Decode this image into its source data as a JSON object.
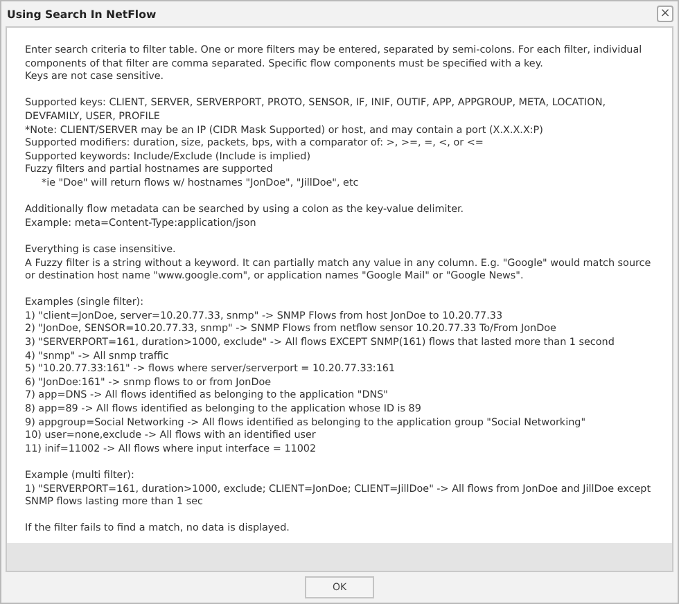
{
  "window": {
    "title": "Using Search In NetFlow",
    "close_symbol": "×"
  },
  "paragraphs": [
    [
      {
        "kind": "plain",
        "text": "Enter search criteria to filter table. One or more filters may be entered, separated by semi-colons. For each filter, individual components of that filter are comma separated. Specific flow components must be specified with a key."
      },
      {
        "kind": "plain",
        "text": "Keys are not case sensitive."
      }
    ],
    [
      {
        "kind": "plain",
        "text": "Supported keys: CLIENT, SERVER, SERVERPORT, PROTO, SENSOR, IF, INIF, OUTIF, APP, APPGROUP, META, LOCATION, DEVFAMILY, USER, PROFILE"
      },
      {
        "kind": "plain",
        "text": "*Note: CLIENT/SERVER may be an IP (CIDR Mask Supported) or host, and may contain a port (X.X.X.X:P)"
      },
      {
        "kind": "plain",
        "text": "Supported modifiers: duration, size, packets, bps, with a comparator of: >, >=, =, <, or <="
      },
      {
        "kind": "plain",
        "text": "Supported keywords: Include/Exclude (Include is implied)"
      },
      {
        "kind": "plain",
        "text": "Fuzzy filters and partial hostnames are supported"
      },
      {
        "kind": "indented",
        "text": "*ie \"Doe\" will return flows w/ hostnames \"JonDoe\", \"JillDoe\", etc"
      }
    ],
    [
      {
        "kind": "plain",
        "text": "Additionally flow metadata can be searched by using a colon as the key-value delimiter."
      },
      {
        "kind": "plain",
        "text": "Example: meta=Content-Type:application/json"
      }
    ],
    [
      {
        "kind": "plain",
        "text": "Everything is case insensitive."
      },
      {
        "kind": "plain",
        "text": "A Fuzzy filter is a string without a keyword. It can partially match any value in any column. E.g. \"Google\" would match source or destination host name \"www.google.com\", or application names \"Google Mail\" or \"Google News\"."
      }
    ],
    [
      {
        "kind": "plain",
        "text": "Examples (single filter):"
      },
      {
        "kind": "plain",
        "text": "1) \"client=JonDoe, server=10.20.77.33, snmp\" -> SNMP Flows from host JonDoe to 10.20.77.33"
      },
      {
        "kind": "plain",
        "text": "2) \"JonDoe, SENSOR=10.20.77.33, snmp\" -> SNMP Flows from netflow sensor 10.20.77.33 To/From JonDoe"
      },
      {
        "kind": "plain",
        "text": "3) \"SERVERPORT=161, duration>1000, exclude\" -> All flows EXCEPT SNMP(161) flows that lasted more than 1 second"
      },
      {
        "kind": "plain",
        "text": "4) \"snmp\" -> All snmp traffic"
      },
      {
        "kind": "plain",
        "text": "5) \"10.20.77.33:161\" -> flows where server/serverport = 10.20.77.33:161"
      },
      {
        "kind": "plain",
        "text": "6) \"JonDoe:161\" -> snmp flows to or from JonDoe"
      },
      {
        "kind": "plain",
        "text": "7) app=DNS -> All flows identified as belonging to the application \"DNS\""
      },
      {
        "kind": "plain",
        "text": "8) app=89 -> All flows identified as belonging to the application whose ID is 89"
      },
      {
        "kind": "plain",
        "text": "9) appgroup=Social Networking -> All flows identified as belonging to the application group \"Social Networking\""
      },
      {
        "kind": "plain",
        "text": "10) user=none,exclude -> All flows with an identified user"
      },
      {
        "kind": "plain",
        "text": "11) inif=11002 -> All flows where input interface = 11002"
      }
    ],
    [
      {
        "kind": "plain",
        "text": "Example (multi filter):"
      },
      {
        "kind": "plain",
        "text": "1) \"SERVERPORT=161, duration>1000, exclude; CLIENT=JonDoe; CLIENT=JillDoe\" -> All flows from JonDoe and JillDoe except SNMP flows lasting more than 1 sec"
      }
    ],
    [
      {
        "kind": "plain",
        "text": "If the filter fails to find a match, no data is displayed."
      }
    ]
  ],
  "buttons": [
    "OK"
  ]
}
